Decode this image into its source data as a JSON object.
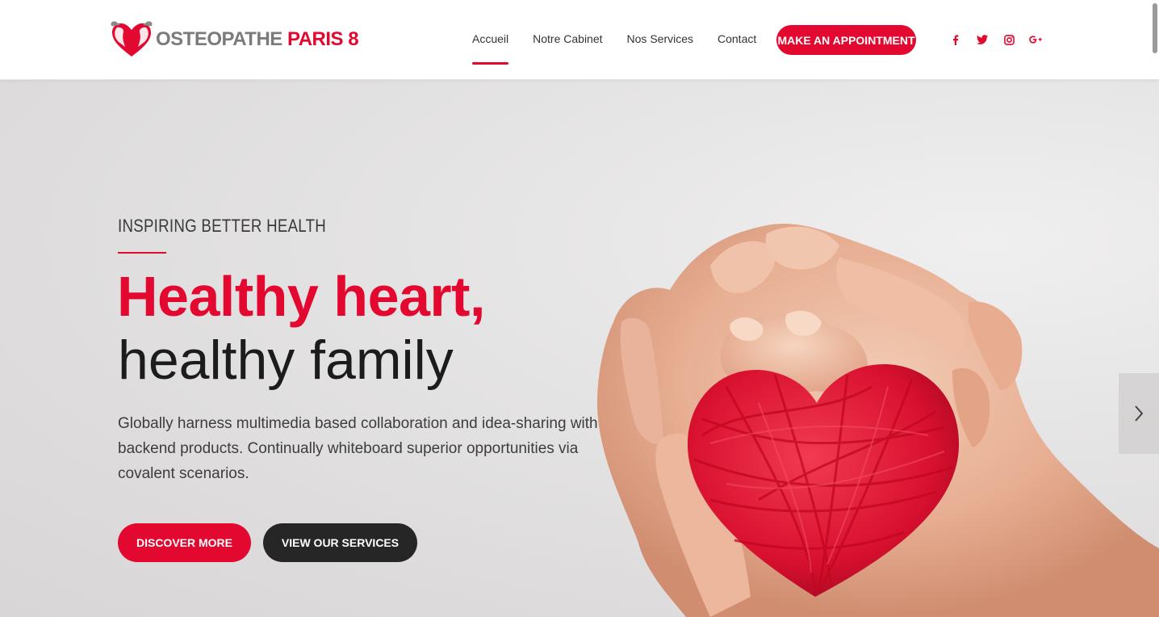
{
  "brand": {
    "name_part1": "OSTEOPATHE",
    "name_part2": "PARIS 8",
    "primary_color": "#e3082f",
    "logo_icon": "hands-heart-icon"
  },
  "nav": {
    "items": [
      {
        "label": "Accueil",
        "active": true
      },
      {
        "label": "Notre Cabinet",
        "active": false
      },
      {
        "label": "Nos Services",
        "active": false
      },
      {
        "label": "Contact",
        "active": false
      }
    ],
    "cta_label": "MAKE AN APPOINTMENT"
  },
  "socials": [
    {
      "icon": "facebook-icon"
    },
    {
      "icon": "twitter-icon"
    },
    {
      "icon": "instagram-icon"
    },
    {
      "icon": "google-plus-icon"
    }
  ],
  "hero": {
    "kicker": "INSPIRING BETTER HEALTH",
    "title_line1": "Healthy heart,",
    "title_line2": "healthy family",
    "description": "Globally harness multimedia based collaboration and idea-sharing with backend products. Continually whiteboard superior opportunities via covalent scenarios.",
    "button_primary": "DISCOVER MORE",
    "button_secondary": "VIEW OUR SERVICES",
    "next_icon": "chevron-right-icon"
  }
}
